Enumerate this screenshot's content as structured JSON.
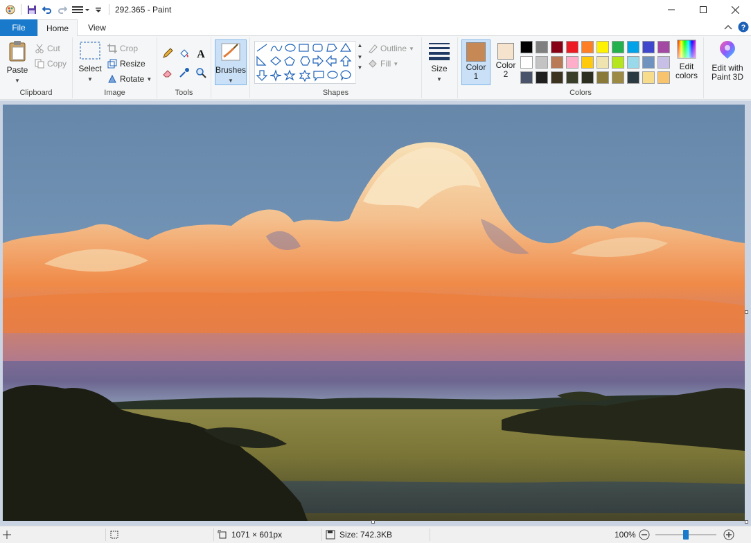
{
  "window": {
    "title": "292.365 - Paint"
  },
  "tabs": {
    "file": "File",
    "home": "Home",
    "view": "View"
  },
  "clipboard": {
    "paste": "Paste",
    "cut": "Cut",
    "copy": "Copy",
    "group": "Clipboard"
  },
  "image": {
    "select": "Select",
    "crop": "Crop",
    "resize": "Resize",
    "rotate": "Rotate",
    "group": "Image"
  },
  "tools": {
    "group": "Tools"
  },
  "brushes": {
    "label": "Brushes"
  },
  "shapes": {
    "outline": "Outline",
    "fill": "Fill",
    "group": "Shapes"
  },
  "size": {
    "label": "Size"
  },
  "colors": {
    "color1_label": "Color",
    "color1_num": "1",
    "color2_label": "Color",
    "color2_num": "2",
    "color1_value": "#c68955",
    "color2_value": "#f5e3cd",
    "edit_colors_1": "Edit",
    "edit_colors_2": "colors",
    "paint3d_1": "Edit with",
    "paint3d_2": "Paint 3D",
    "group": "Colors",
    "palette_row1": [
      "#000000",
      "#7f7f7f",
      "#880015",
      "#ed1c24",
      "#ff7f27",
      "#fff200",
      "#22b14c",
      "#00a2e8",
      "#3f48cc",
      "#a349a4"
    ],
    "palette_row2": [
      "#ffffff",
      "#c3c3c3",
      "#b97a57",
      "#ffaec9",
      "#ffc90e",
      "#efe4b0",
      "#b5e61d",
      "#99d9ea",
      "#7092be",
      "#c8bfe7"
    ],
    "palette_row3": [
      "#495369",
      "#1f1f1f",
      "#3b3320",
      "#3a3f2a",
      "#2c2f1f",
      "#8a7a3a",
      "#9a8a44",
      "#2b3a40",
      "#f7dc8c",
      "#f7c36c"
    ]
  },
  "status": {
    "dimensions": "1071 × 601px",
    "size": "Size: 742.3KB",
    "zoom": "100%"
  }
}
